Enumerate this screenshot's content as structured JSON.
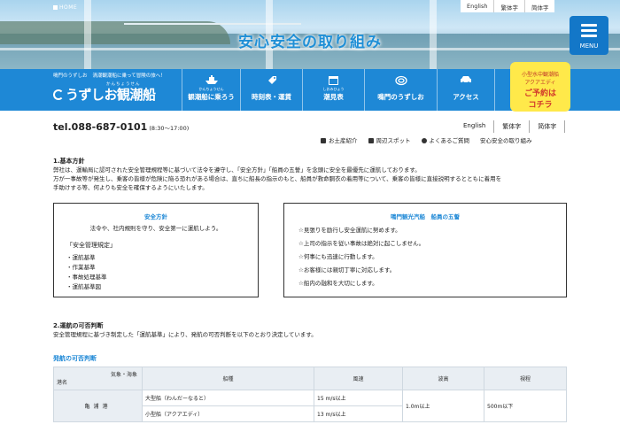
{
  "header": {
    "breadcrumb": "HOME",
    "hero_title": "安心安全の取り組み",
    "languages": [
      "English",
      "繁体字",
      "简体字"
    ],
    "menu_label": "MENU"
  },
  "brand": {
    "tagline_left": "鳴門のうずしお",
    "tagline_right": "渦潮観潮船に乗って冒険の旅へ！",
    "logo_kana": "かんちょうせん",
    "logo_text": "うずしお観潮船"
  },
  "nav": {
    "items": [
      {
        "sub": "かんちょうせん",
        "label": "観潮船に乗ろう",
        "icon": "ship-icon"
      },
      {
        "sub": "",
        "label": "時刻表・運賃",
        "icon": "ticket-icon"
      },
      {
        "sub": "しおみひょう",
        "label": "潮見表",
        "icon": "calendar-icon"
      },
      {
        "sub": "",
        "label": "鳴門のうずしお",
        "icon": "whirlpool-icon"
      },
      {
        "sub": "",
        "label": "アクセス",
        "icon": "car-icon"
      }
    ]
  },
  "promo": {
    "line1": "小型水中観潮船",
    "line2": "アクアエディ",
    "line3": "ご予約は",
    "line4": "コチラ"
  },
  "contact": {
    "tel": "tel.088-687-0101",
    "hours": "(8:30〜17:00)"
  },
  "languages_sub": [
    "English",
    "繁体字",
    "简体字"
  ],
  "sublinks": [
    "お土産紹介",
    "周辺スポット",
    "よくあるご質問",
    "安心安全の取り組み"
  ],
  "section1": {
    "heading": "1.基本方針",
    "text1": "弊社は、運輸局に認可された安全管理規程等に基づいて法令を遵守し、「安全方針」「船員の五誓」を念頭に安全を最優先に運航しております。",
    "text2": "万が一事故等が発生し、乗客の皆様が危険に陥る恐れがある場合は、直ちに船長の指示のもと、船員が救命胴衣の着用等について、乗客の皆様に直接説明するとともに着用を",
    "text3": "手助けする等、何よりも安全を確保するようにいたします。"
  },
  "policy_box": {
    "title": "安全方針",
    "subtitle": "法令や、社内規則を守り、安全第一に運航しよう。",
    "rules_heading": "「安全管理規定」",
    "rules": [
      "・運航基準",
      "・作業基準",
      "・事故処理基準",
      "・運航基準図"
    ]
  },
  "vows_box": {
    "title": "鳴門観光汽船　船員の五誓",
    "vows": [
      "☆見張りを励行し安全運航に努めます。",
      "☆上司の指示を従い事故は絶対に起こしません。",
      "☆何事にも迅速に行動します。",
      "☆お客様には親切丁寧に対応します。",
      "☆船内の融和を大切にします。"
    ]
  },
  "section2": {
    "heading": "2.運航の可否判断",
    "text": "安全管理規程に基づき制定した「運航基準」により、発航の可否判断を以下のとおり決定しています。"
  },
  "table": {
    "title": "発航の可否判断",
    "corner_top": "気象・海象",
    "corner_bottom": "港名",
    "headers": [
      "船種",
      "風速",
      "波高",
      "視程"
    ],
    "port": "亀浦港",
    "rows": [
      {
        "vessel": "大型船（わんだーなると）",
        "wind": "15 m/s以上"
      },
      {
        "vessel": "小型船（アクアエディ）",
        "wind": "13 m/s以上"
      }
    ],
    "wave": "1.0m以上",
    "visibility": "500m以下"
  },
  "colors": {
    "brand_blue": "#1e88d6",
    "menu_blue": "#1377c8",
    "promo_yellow": "#ffe94a",
    "promo_red": "#d23a2b"
  }
}
